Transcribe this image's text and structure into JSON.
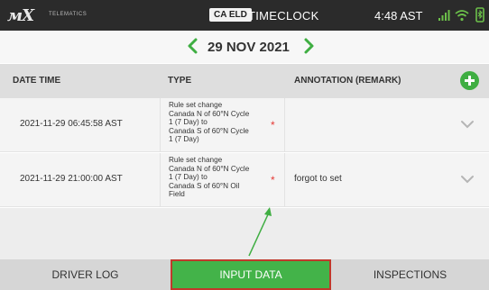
{
  "topbar": {
    "logo_text": "мX",
    "logo_sub": "TELEMATICS",
    "badge": "CA ELD",
    "title": "TIMECLOCK",
    "time": "4:48 AST"
  },
  "datebar": {
    "date": "29 NOV 2021",
    "prev_icon": "chevron-left-icon",
    "next_icon": "chevron-right-icon",
    "accent": "#3fae42"
  },
  "table": {
    "headers": {
      "date": "DATE TIME",
      "type": "TYPE",
      "annotation": "ANNOTATION (REMARK)"
    },
    "rows": [
      {
        "date": "2021-11-29 06:45:58 AST",
        "type_lines": [
          "Rule set change",
          "Canada N of 60°N Cycle",
          "1 (7 Day) to",
          "Canada S of 60°N Cycle",
          "1 (7 Day)"
        ],
        "required_mark": "*",
        "annotation": ""
      },
      {
        "date": "2021-11-29 21:00:00 AST",
        "type_lines": [
          "Rule set change",
          "Canada N of 60°N Cycle",
          "1 (7 Day) to",
          "Canada S of 60°N Oil",
          "Field"
        ],
        "required_mark": "*",
        "annotation": "forgot to set"
      }
    ]
  },
  "tabs": {
    "driver_log": "DRIVER LOG",
    "input_data": "INPUT DATA",
    "inspections": "INSPECTIONS",
    "active": "INPUT DATA"
  },
  "colors": {
    "active_tab": "#43b349",
    "active_border": "#c0392b",
    "required_star": "#e53935",
    "add_button": "#3fae42"
  }
}
